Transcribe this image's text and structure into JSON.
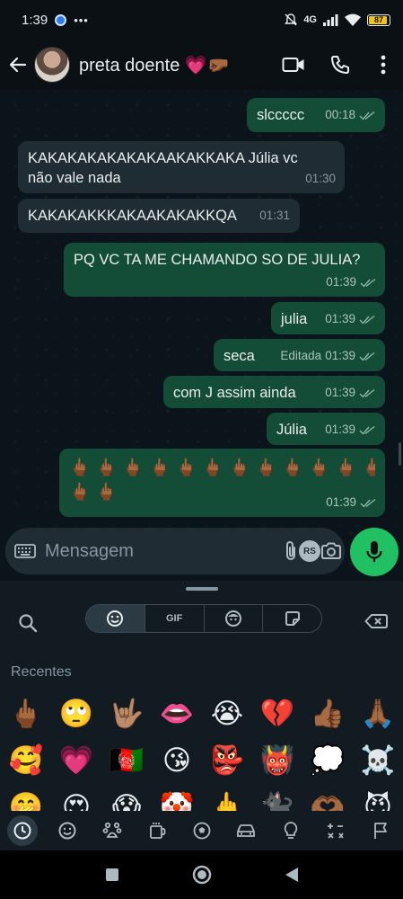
{
  "status_bar": {
    "time": "1:39",
    "network": "4G",
    "battery": "87"
  },
  "header": {
    "contact_name": "preta doente 💗🤛🏾"
  },
  "messages": [
    {
      "dir": "out",
      "text": "slccccc",
      "time": "00:18",
      "edited": ""
    },
    {
      "dir": "in",
      "text": "KAKAKAKAKAKAKAAKAKKAKA Júlia vc não vale nada",
      "time": "01:30",
      "edited": ""
    },
    {
      "dir": "in",
      "text": "KAKAKAKKKAKAAKAKAKKQA",
      "time": "01:31",
      "edited": ""
    },
    {
      "dir": "out",
      "text": "PQ VC TA ME CHAMANDO SO DE JULIA?",
      "time": "01:39",
      "edited": ""
    },
    {
      "dir": "out",
      "text": "julia",
      "time": "01:39",
      "edited": ""
    },
    {
      "dir": "out",
      "text": "seca",
      "time": "01:39",
      "edited": "Editada"
    },
    {
      "dir": "out",
      "text": "com J assim ainda",
      "time": "01:39",
      "edited": ""
    },
    {
      "dir": "out",
      "text": "Júlia",
      "time": "01:39",
      "edited": ""
    },
    {
      "dir": "out",
      "text": "🖕🏾🖕🏾🖕🏾🖕🏾🖕🏾🖕🏾🖕🏾🖕🏾🖕🏾🖕🏾🖕🏾🖕🏾",
      "text_line2": "🖕🏾🖕🏾",
      "time": "01:39",
      "edited": ""
    }
  ],
  "input": {
    "placeholder": "Mensagem",
    "rs_badge": "RS"
  },
  "emoji_panel": {
    "tabs": [
      "emoji",
      "GIF",
      "avatar",
      "sticker"
    ],
    "recent_label": "Recentes",
    "emojis": [
      "🖕🏾",
      "🙄",
      "🤟🏽",
      "👄",
      "😭",
      "💔",
      "👍🏾",
      "🙏🏾",
      "🥰",
      "💗",
      "🇦🇫",
      "😘",
      "👺",
      "👹",
      "💭",
      "☠️",
      "🤭",
      "😍",
      "😱",
      "🤡",
      "🖕",
      "🐈‍⬛",
      "🫶🏾",
      "😈"
    ],
    "categories": [
      "recent-icon",
      "smiley-icon",
      "animals-icon",
      "food-icon",
      "activity-icon",
      "travel-icon",
      "objects-icon",
      "symbols-icon",
      "flags-icon"
    ]
  },
  "colors": {
    "outgoing": "#144d37",
    "incoming": "#1f2c34",
    "accent": "#21c063",
    "background": "#0b141a"
  }
}
